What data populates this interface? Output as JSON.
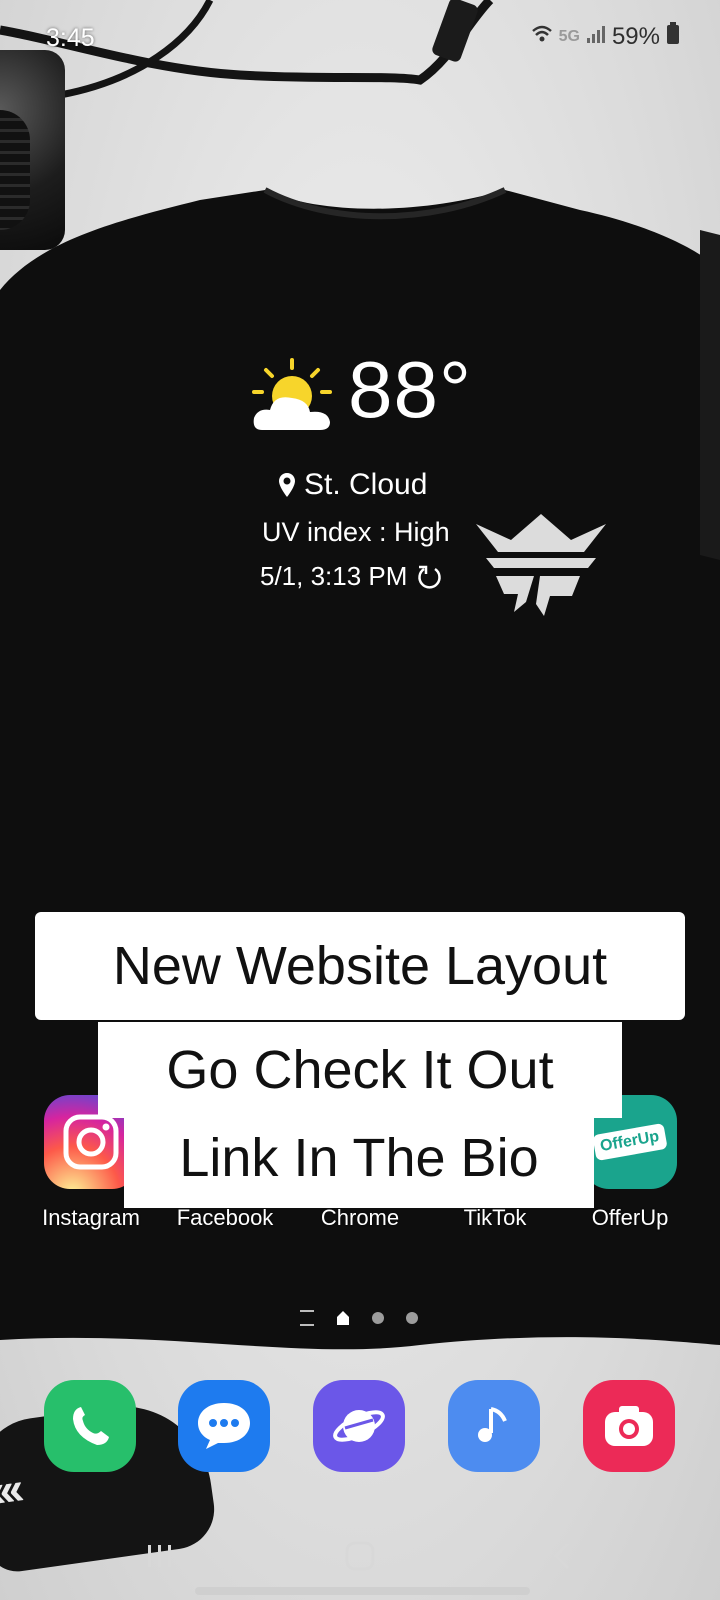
{
  "status_bar": {
    "time": "3:45",
    "network": "5G",
    "battery": "59%"
  },
  "weather": {
    "temperature": "88°",
    "location": "St. Cloud",
    "uv_index": "UV index : High",
    "updated": "5/1, 3:13 PM"
  },
  "overlay": {
    "line1": "New Website Layout",
    "line2": "Go Check It Out",
    "line3": "Link In The Bio"
  },
  "apps": [
    {
      "label": "Instagram",
      "icon": "instagram-icon"
    },
    {
      "label": "Facebook",
      "icon": "facebook-icon"
    },
    {
      "label": "Chrome",
      "icon": "chrome-icon"
    },
    {
      "label": "TikTok",
      "icon": "tiktok-icon"
    },
    {
      "label": "OfferUp",
      "icon": "offerup-icon"
    }
  ],
  "offerup_logo_text": "OfferUp",
  "pager": {
    "total_pages": 3,
    "active_page": 1
  },
  "dock": [
    {
      "icon": "phone-icon"
    },
    {
      "icon": "messages-icon"
    },
    {
      "icon": "internet-browser-icon"
    },
    {
      "icon": "music-icon"
    },
    {
      "icon": "camera-icon"
    }
  ],
  "colors": {
    "phone": "#27bf6b",
    "messages": "#1e7bef",
    "browser": "#6b57e8",
    "music": "#4d8cf0",
    "camera": "#ec2a57",
    "offerup": "#1aa48d",
    "shirt": "#0e0e0e"
  }
}
